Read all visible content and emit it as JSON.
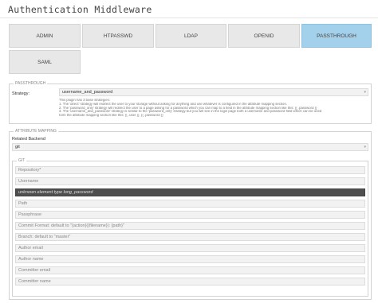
{
  "page_title": "Authentication Middleware",
  "tabs": [
    {
      "label": "ADMIN",
      "active": false
    },
    {
      "label": "HTPASSWD",
      "active": false
    },
    {
      "label": "LDAP",
      "active": false
    },
    {
      "label": "OPENID",
      "active": false
    },
    {
      "label": "PASSTHROUGH",
      "active": true
    },
    {
      "label": "SAML",
      "active": false
    }
  ],
  "passthrough": {
    "legend": "PASSTHROUGH",
    "strategy_label": "Strategy:",
    "strategy_value": "username_and_password",
    "help": [
      "This plugin has 3 base strategies:",
      "1. The 'direct' strategy will redirect the user to your storage without asking for anything and use whatever is configured in the attribute mapping section.",
      "2. The 'password_only' strategy will redirect the user to a page asking for a password which you can map to a field in the attribute mapping section like this: {{ .password }}",
      "3. The 'username_and_password' strategy is similar to the 'password_only' strategy but you will see in the login page both a username and password field which can be used",
      "form the attribute mapping section like this: {{ .user }}, {{ .password }}"
    ]
  },
  "attribute_mapping": {
    "legend": "ATTRIBUTE MAPPING",
    "related_backend_label": "Related Backend",
    "related_backend_value": "git",
    "git": {
      "legend": "GIT",
      "fields": [
        {
          "placeholder": "Repository*",
          "dark": false
        },
        {
          "placeholder": "Username",
          "dark": false
        },
        {
          "placeholder": "unknown element type long_password",
          "dark": true
        },
        {
          "placeholder": "Path",
          "dark": false
        },
        {
          "placeholder": "Passphrase",
          "dark": false
        },
        {
          "placeholder": "Commit Format: default to \"{action}({filename}): {path}\"",
          "dark": false
        },
        {
          "placeholder": "Branch: default to \"master\"",
          "dark": false
        },
        {
          "placeholder": "Author email",
          "dark": false
        },
        {
          "placeholder": "Author name",
          "dark": false
        },
        {
          "placeholder": "Committer email",
          "dark": false
        },
        {
          "placeholder": "Committer name",
          "dark": false
        }
      ]
    }
  }
}
